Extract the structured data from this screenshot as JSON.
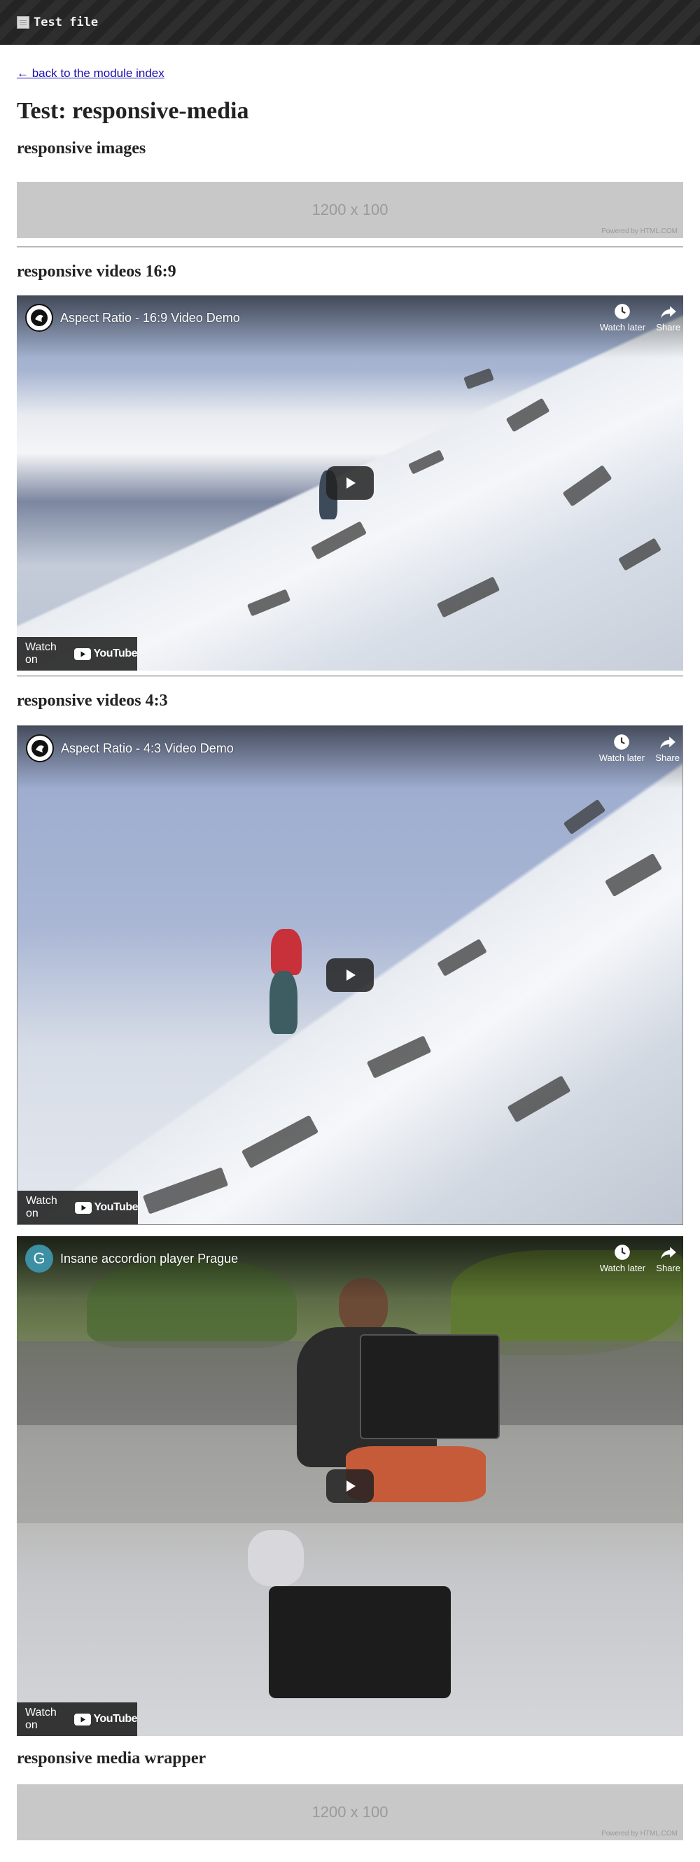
{
  "header": {
    "title": "Test file"
  },
  "nav": {
    "back_link": "← back to the module index"
  },
  "page": {
    "title": "Test: responsive-media"
  },
  "sections": {
    "images": {
      "heading": "responsive images",
      "placeholder_size": "1200 x 100",
      "placeholder_credit": "Powered by HTML.COM"
    },
    "video169": {
      "heading": "responsive videos 16:9",
      "video_title": "Aspect Ratio - 16:9 Video Demo"
    },
    "video43": {
      "heading": "responsive videos 4:3",
      "video_title": "Aspect Ratio - 4:3 Video Demo"
    },
    "video_accordion": {
      "video_title": "Insane accordion player Prague",
      "avatar_letter": "G",
      "avatar_color": "#3d8fa3"
    },
    "wrapper": {
      "heading": "responsive media wrapper",
      "placeholder_size": "1200 x 100",
      "placeholder_credit": "Powered by HTML.COM"
    }
  },
  "video_controls": {
    "watch_later": "Watch later",
    "share": "Share",
    "watch_on": "Watch on",
    "youtube": "YouTube"
  },
  "colors": {
    "link": "#1a0dab",
    "youtube_red": "#ff0000",
    "topbar": "#2a2a2a",
    "placeholder_bg": "#c8c8c8"
  },
  "icons": [
    "file-icon",
    "clock-icon",
    "share-arrow-icon",
    "play-icon",
    "youtube-logo-icon",
    "channel-avatar-icon"
  ]
}
